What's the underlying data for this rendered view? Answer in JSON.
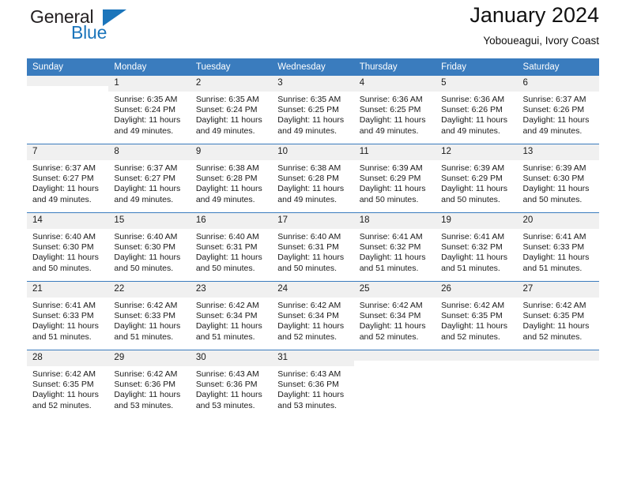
{
  "brand": {
    "name_part1": "General",
    "name_part2": "Blue",
    "flag_icon": "triangle-flag-icon",
    "accent_color": "#1b75bb"
  },
  "header": {
    "title": "January 2024",
    "subtitle": "Yoboueagui, Ivory Coast"
  },
  "calendar": {
    "header_color": "#3a7cbe",
    "weekday_headers": [
      "Sunday",
      "Monday",
      "Tuesday",
      "Wednesday",
      "Thursday",
      "Friday",
      "Saturday"
    ],
    "weeks": [
      [
        {
          "day": "",
          "sunrise": "",
          "sunset": "",
          "daylight_l1": "",
          "daylight_l2": "",
          "empty": true
        },
        {
          "day": "1",
          "sunrise": "Sunrise: 6:35 AM",
          "sunset": "Sunset: 6:24 PM",
          "daylight_l1": "Daylight: 11 hours",
          "daylight_l2": "and 49 minutes."
        },
        {
          "day": "2",
          "sunrise": "Sunrise: 6:35 AM",
          "sunset": "Sunset: 6:24 PM",
          "daylight_l1": "Daylight: 11 hours",
          "daylight_l2": "and 49 minutes."
        },
        {
          "day": "3",
          "sunrise": "Sunrise: 6:35 AM",
          "sunset": "Sunset: 6:25 PM",
          "daylight_l1": "Daylight: 11 hours",
          "daylight_l2": "and 49 minutes."
        },
        {
          "day": "4",
          "sunrise": "Sunrise: 6:36 AM",
          "sunset": "Sunset: 6:25 PM",
          "daylight_l1": "Daylight: 11 hours",
          "daylight_l2": "and 49 minutes."
        },
        {
          "day": "5",
          "sunrise": "Sunrise: 6:36 AM",
          "sunset": "Sunset: 6:26 PM",
          "daylight_l1": "Daylight: 11 hours",
          "daylight_l2": "and 49 minutes."
        },
        {
          "day": "6",
          "sunrise": "Sunrise: 6:37 AM",
          "sunset": "Sunset: 6:26 PM",
          "daylight_l1": "Daylight: 11 hours",
          "daylight_l2": "and 49 minutes."
        }
      ],
      [
        {
          "day": "7",
          "sunrise": "Sunrise: 6:37 AM",
          "sunset": "Sunset: 6:27 PM",
          "daylight_l1": "Daylight: 11 hours",
          "daylight_l2": "and 49 minutes."
        },
        {
          "day": "8",
          "sunrise": "Sunrise: 6:37 AM",
          "sunset": "Sunset: 6:27 PM",
          "daylight_l1": "Daylight: 11 hours",
          "daylight_l2": "and 49 minutes."
        },
        {
          "day": "9",
          "sunrise": "Sunrise: 6:38 AM",
          "sunset": "Sunset: 6:28 PM",
          "daylight_l1": "Daylight: 11 hours",
          "daylight_l2": "and 49 minutes."
        },
        {
          "day": "10",
          "sunrise": "Sunrise: 6:38 AM",
          "sunset": "Sunset: 6:28 PM",
          "daylight_l1": "Daylight: 11 hours",
          "daylight_l2": "and 49 minutes."
        },
        {
          "day": "11",
          "sunrise": "Sunrise: 6:39 AM",
          "sunset": "Sunset: 6:29 PM",
          "daylight_l1": "Daylight: 11 hours",
          "daylight_l2": "and 50 minutes."
        },
        {
          "day": "12",
          "sunrise": "Sunrise: 6:39 AM",
          "sunset": "Sunset: 6:29 PM",
          "daylight_l1": "Daylight: 11 hours",
          "daylight_l2": "and 50 minutes."
        },
        {
          "day": "13",
          "sunrise": "Sunrise: 6:39 AM",
          "sunset": "Sunset: 6:30 PM",
          "daylight_l1": "Daylight: 11 hours",
          "daylight_l2": "and 50 minutes."
        }
      ],
      [
        {
          "day": "14",
          "sunrise": "Sunrise: 6:40 AM",
          "sunset": "Sunset: 6:30 PM",
          "daylight_l1": "Daylight: 11 hours",
          "daylight_l2": "and 50 minutes."
        },
        {
          "day": "15",
          "sunrise": "Sunrise: 6:40 AM",
          "sunset": "Sunset: 6:30 PM",
          "daylight_l1": "Daylight: 11 hours",
          "daylight_l2": "and 50 minutes."
        },
        {
          "day": "16",
          "sunrise": "Sunrise: 6:40 AM",
          "sunset": "Sunset: 6:31 PM",
          "daylight_l1": "Daylight: 11 hours",
          "daylight_l2": "and 50 minutes."
        },
        {
          "day": "17",
          "sunrise": "Sunrise: 6:40 AM",
          "sunset": "Sunset: 6:31 PM",
          "daylight_l1": "Daylight: 11 hours",
          "daylight_l2": "and 50 minutes."
        },
        {
          "day": "18",
          "sunrise": "Sunrise: 6:41 AM",
          "sunset": "Sunset: 6:32 PM",
          "daylight_l1": "Daylight: 11 hours",
          "daylight_l2": "and 51 minutes."
        },
        {
          "day": "19",
          "sunrise": "Sunrise: 6:41 AM",
          "sunset": "Sunset: 6:32 PM",
          "daylight_l1": "Daylight: 11 hours",
          "daylight_l2": "and 51 minutes."
        },
        {
          "day": "20",
          "sunrise": "Sunrise: 6:41 AM",
          "sunset": "Sunset: 6:33 PM",
          "daylight_l1": "Daylight: 11 hours",
          "daylight_l2": "and 51 minutes."
        }
      ],
      [
        {
          "day": "21",
          "sunrise": "Sunrise: 6:41 AM",
          "sunset": "Sunset: 6:33 PM",
          "daylight_l1": "Daylight: 11 hours",
          "daylight_l2": "and 51 minutes."
        },
        {
          "day": "22",
          "sunrise": "Sunrise: 6:42 AM",
          "sunset": "Sunset: 6:33 PM",
          "daylight_l1": "Daylight: 11 hours",
          "daylight_l2": "and 51 minutes."
        },
        {
          "day": "23",
          "sunrise": "Sunrise: 6:42 AM",
          "sunset": "Sunset: 6:34 PM",
          "daylight_l1": "Daylight: 11 hours",
          "daylight_l2": "and 51 minutes."
        },
        {
          "day": "24",
          "sunrise": "Sunrise: 6:42 AM",
          "sunset": "Sunset: 6:34 PM",
          "daylight_l1": "Daylight: 11 hours",
          "daylight_l2": "and 52 minutes."
        },
        {
          "day": "25",
          "sunrise": "Sunrise: 6:42 AM",
          "sunset": "Sunset: 6:34 PM",
          "daylight_l1": "Daylight: 11 hours",
          "daylight_l2": "and 52 minutes."
        },
        {
          "day": "26",
          "sunrise": "Sunrise: 6:42 AM",
          "sunset": "Sunset: 6:35 PM",
          "daylight_l1": "Daylight: 11 hours",
          "daylight_l2": "and 52 minutes."
        },
        {
          "day": "27",
          "sunrise": "Sunrise: 6:42 AM",
          "sunset": "Sunset: 6:35 PM",
          "daylight_l1": "Daylight: 11 hours",
          "daylight_l2": "and 52 minutes."
        }
      ],
      [
        {
          "day": "28",
          "sunrise": "Sunrise: 6:42 AM",
          "sunset": "Sunset: 6:35 PM",
          "daylight_l1": "Daylight: 11 hours",
          "daylight_l2": "and 52 minutes."
        },
        {
          "day": "29",
          "sunrise": "Sunrise: 6:42 AM",
          "sunset": "Sunset: 6:36 PM",
          "daylight_l1": "Daylight: 11 hours",
          "daylight_l2": "and 53 minutes."
        },
        {
          "day": "30",
          "sunrise": "Sunrise: 6:43 AM",
          "sunset": "Sunset: 6:36 PM",
          "daylight_l1": "Daylight: 11 hours",
          "daylight_l2": "and 53 minutes."
        },
        {
          "day": "31",
          "sunrise": "Sunrise: 6:43 AM",
          "sunset": "Sunset: 6:36 PM",
          "daylight_l1": "Daylight: 11 hours",
          "daylight_l2": "and 53 minutes."
        },
        {
          "day": "",
          "sunrise": "",
          "sunset": "",
          "daylight_l1": "",
          "daylight_l2": "",
          "empty": true
        },
        {
          "day": "",
          "sunrise": "",
          "sunset": "",
          "daylight_l1": "",
          "daylight_l2": "",
          "empty": true
        },
        {
          "day": "",
          "sunrise": "",
          "sunset": "",
          "daylight_l1": "",
          "daylight_l2": "",
          "empty": true
        }
      ]
    ]
  }
}
